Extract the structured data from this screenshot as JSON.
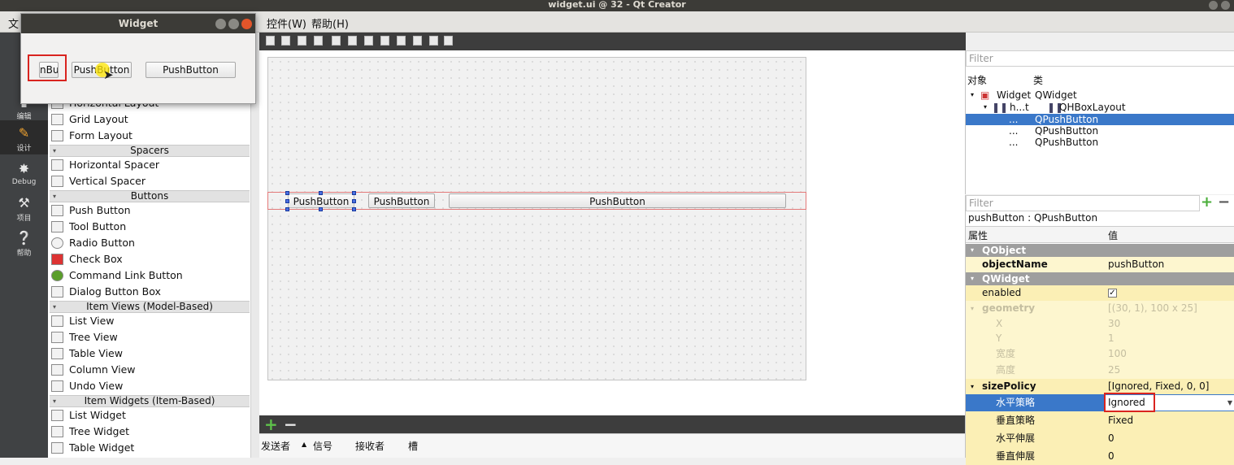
{
  "window": {
    "title": "widget.ui @ 32 - Qt Creator"
  },
  "menubar": {
    "file_stub": "文",
    "controls": "控件(W)",
    "help": "帮助(H)"
  },
  "modes": [
    {
      "label": "编辑",
      "icon": "edit-icon"
    },
    {
      "label": "设计",
      "icon": "pencil-icon"
    },
    {
      "label": "Debug",
      "icon": "bug-icon"
    },
    {
      "label": "项目",
      "icon": "wrench-icon"
    },
    {
      "label": "帮助",
      "icon": "help-icon"
    }
  ],
  "widgetbox": {
    "items_top": [
      "Horizontal Layout",
      "Grid Layout",
      "Form Layout"
    ],
    "spacers_title": "Spacers",
    "spacers": [
      "Horizontal Spacer",
      "Vertical Spacer"
    ],
    "buttons_title": "Buttons",
    "buttons": [
      "Push Button",
      "Tool Button",
      "Radio Button",
      "Check Box",
      "Command Link Button",
      "Dialog Button Box"
    ],
    "itemviews_title": "Item Views (Model-Based)",
    "itemviews": [
      "List View",
      "Tree View",
      "Table View",
      "Column View",
      "Undo View"
    ],
    "itemwidgets_title": "Item Widgets (Item-Based)",
    "itemwidgets": [
      "List Widget",
      "Tree Widget",
      "Table Widget"
    ]
  },
  "preview": {
    "title": "Widget",
    "btn1": "nBu",
    "btn2": "PushButton",
    "btn3": "PushButton"
  },
  "canvas": {
    "btn1": "PushButton",
    "btn2": "PushButton",
    "btn3": "PushButton"
  },
  "signals": {
    "headers": [
      "发送者",
      "信号",
      "接收者",
      "槽"
    ]
  },
  "object_inspector": {
    "filter_placeholder": "Filter",
    "col_object": "对象",
    "col_class": "类",
    "rows": [
      {
        "name": "Widget",
        "cls": "QWidget"
      },
      {
        "name": "h...t",
        "cls": "QHBoxLayout"
      },
      {
        "name": "...",
        "cls": "QPushButton"
      },
      {
        "name": "...",
        "cls": "QPushButton"
      },
      {
        "name": "...",
        "cls": "QPushButton"
      }
    ]
  },
  "property_editor": {
    "filter_placeholder": "Filter",
    "object_label": "pushButton : QPushButton",
    "col_prop": "属性",
    "col_value": "值",
    "qobject": "QObject",
    "objectName_k": "objectName",
    "objectName_v": "pushButton",
    "qwidget": "QWidget",
    "enabled_k": "enabled",
    "enabled_v": "✓",
    "geometry_k": "geometry",
    "geometry_v": "[(30, 1), 100 x 25]",
    "x_k": "X",
    "x_v": "30",
    "y_k": "Y",
    "y_v": "1",
    "w_k": "宽度",
    "w_v": "100",
    "h_k": "高度",
    "h_v": "25",
    "sizePolicy_k": "sizePolicy",
    "sizePolicy_v": "[Ignored, Fixed, 0, 0]",
    "hpolicy_k": "水平策略",
    "hpolicy_v": "Ignored",
    "vpolicy_k": "垂直策略",
    "vpolicy_v": "Fixed",
    "hstretch_k": "水平伸展",
    "hstretch_v": "0",
    "vstretch_k": "垂直伸展",
    "vstretch_v": "0"
  }
}
